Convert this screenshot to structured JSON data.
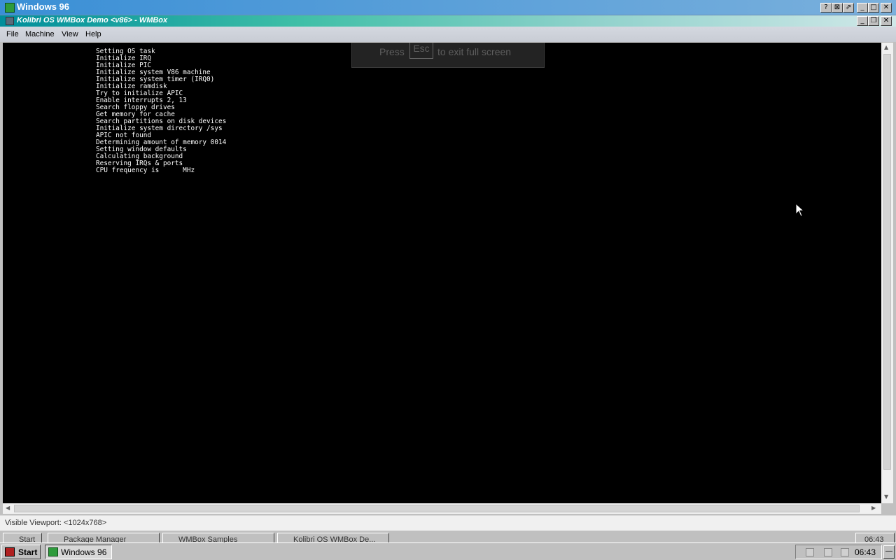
{
  "outer_window": {
    "title": "Windows 96",
    "controls": [
      "?",
      "⊠",
      "⇗",
      "_",
      "□",
      "✕"
    ]
  },
  "inner_window": {
    "title": "Kolibri OS WMBox Demo <v86> - WMBox",
    "controls": [
      "_",
      "❐",
      "✕"
    ]
  },
  "menu": {
    "file": "File",
    "machine": "Machine",
    "view": "View",
    "help": "Help"
  },
  "fullscreen_hint": {
    "press": "Press",
    "key": "Esc",
    "rest": "to exit full screen"
  },
  "console_lines": [
    "Setting OS task",
    "Initialize IRQ",
    "Initialize PIC",
    "Initialize system V86 machine",
    "Initialize system timer (IRQ0)",
    "Initialize ramdisk",
    "Try to initialize APIC",
    "Enable interrupts 2, 13",
    "Search floppy drives",
    "Get memory for cache",
    "Search partitions on disk devices",
    "Initialize system directory /sys",
    "APIC not found",
    "Determining amount of memory 0014",
    "Setting window defaults",
    "Calculating background",
    "Reserving IRQs & ports",
    "CPU frequency is      MHz"
  ],
  "status_bar": {
    "text": "Visible Viewport: <1024x768>"
  },
  "background_taskbar": {
    "start": "Start",
    "items": [
      "Package Manager",
      "WMBox Samples",
      "Kolibri OS WMBox De..."
    ],
    "clock": "06:43"
  },
  "taskbar": {
    "start": "Start",
    "active_task": "Windows 96",
    "clock": "06:43",
    "tray_icons": [
      "speaker-icon",
      "network-icon",
      "resize-icon"
    ]
  }
}
